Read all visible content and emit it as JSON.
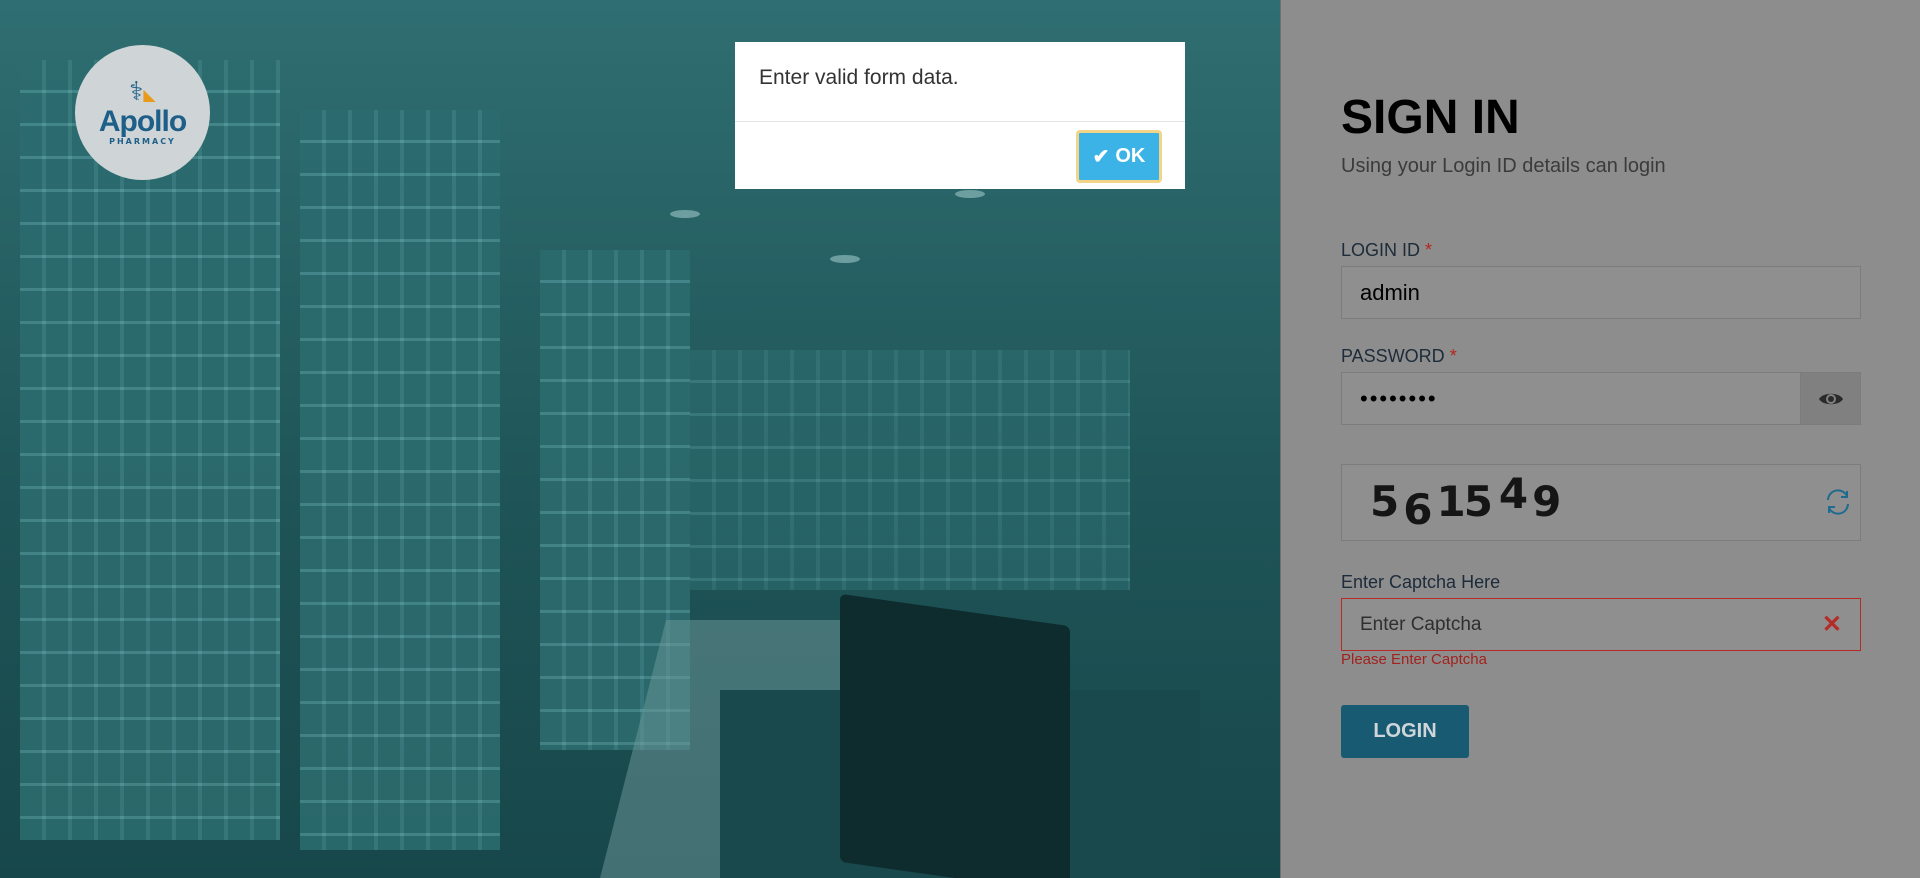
{
  "brand": {
    "logo_name": "Apollo",
    "logo_sub": "PHARMACY"
  },
  "signin": {
    "title": "SIGN IN",
    "subtitle": "Using your Login ID details can login"
  },
  "form": {
    "login_id_label": "LOGIN ID",
    "required_mark": "*",
    "login_id_value": "admin",
    "password_label": "PASSWORD",
    "password_value": "••••••••",
    "captcha_digits": [
      "5",
      "6",
      "15",
      "4",
      "9"
    ],
    "captcha_label": "Enter Captcha Here",
    "captcha_placeholder": "Enter Captcha",
    "captcha_error": "Please Enter Captcha",
    "login_button": "LOGIN"
  },
  "alert": {
    "message": "Enter valid form data.",
    "ok_label": "OK"
  },
  "colors": {
    "accent": "#195a73",
    "ok_button": "#3bb3e6",
    "error": "#b52b27"
  },
  "icons": [
    "eye-icon",
    "refresh-icon",
    "close-icon",
    "check-icon"
  ]
}
